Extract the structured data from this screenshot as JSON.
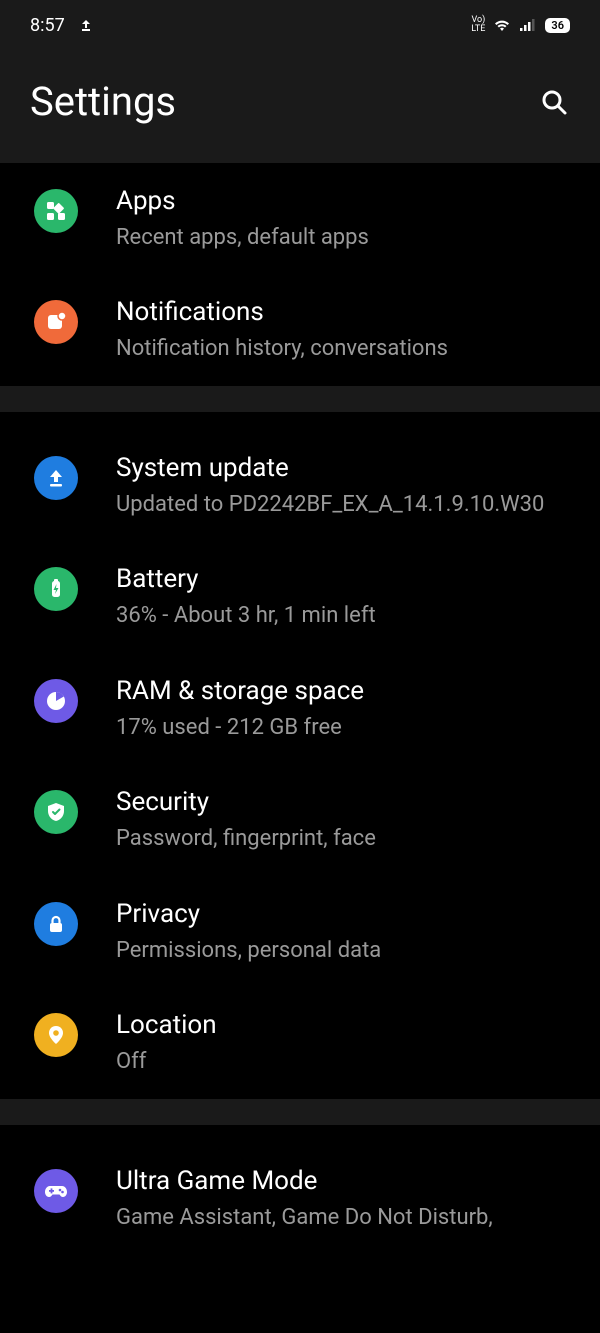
{
  "status": {
    "time": "8:57",
    "battery": "36"
  },
  "header": {
    "title": "Settings"
  },
  "groups": [
    {
      "items": [
        {
          "key": "apps",
          "icon": "apps-icon",
          "color": "ic-green",
          "title": "Apps",
          "sub": "Recent apps, default apps"
        },
        {
          "key": "notifications",
          "icon": "notifications-icon",
          "color": "ic-orange",
          "title": "Notifications",
          "sub": "Notification history, conversations"
        }
      ]
    },
    {
      "items": [
        {
          "key": "system-update",
          "icon": "update-icon",
          "color": "ic-blue",
          "title": "System update",
          "sub": "Updated to PD2242BF_EX_A_14.1.9.10.W30"
        },
        {
          "key": "battery",
          "icon": "battery-icon",
          "color": "ic-green",
          "title": "Battery",
          "sub": "36% - About 3 hr, 1 min left"
        },
        {
          "key": "ram-storage",
          "icon": "storage-icon",
          "color": "ic-purple",
          "title": "RAM & storage space",
          "sub": "17% used - 212 GB free"
        },
        {
          "key": "security",
          "icon": "shield-icon",
          "color": "ic-green",
          "title": "Security",
          "sub": "Password, fingerprint, face"
        },
        {
          "key": "privacy",
          "icon": "lock-icon",
          "color": "ic-blue",
          "title": "Privacy",
          "sub": "Permissions, personal data"
        },
        {
          "key": "location",
          "icon": "location-icon",
          "color": "ic-yellow",
          "title": "Location",
          "sub": "Off"
        }
      ]
    },
    {
      "items": [
        {
          "key": "ultra-game-mode",
          "icon": "game-icon",
          "color": "ic-purple",
          "title": "Ultra Game Mode",
          "sub": "Game Assistant, Game Do Not Disturb,"
        }
      ]
    }
  ]
}
